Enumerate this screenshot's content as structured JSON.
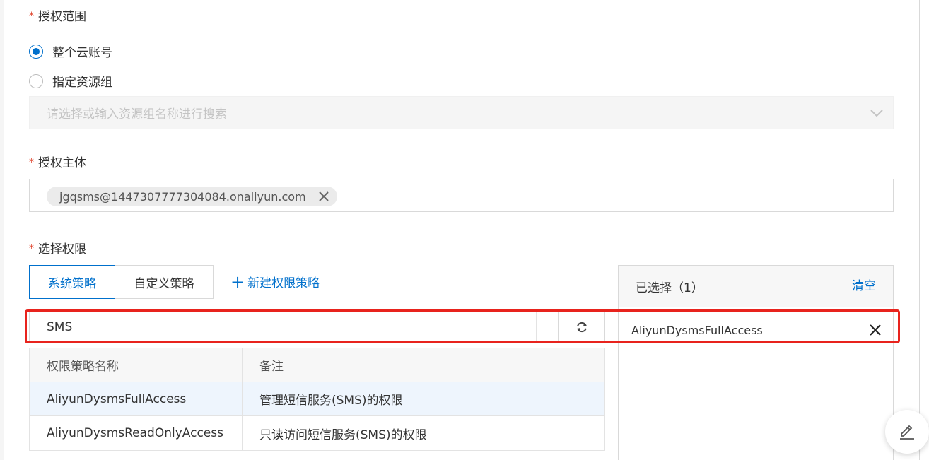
{
  "scope": {
    "label": "授权范围",
    "options": [
      {
        "label": "整个云账号",
        "checked": true
      },
      {
        "label": "指定资源组",
        "checked": false
      }
    ],
    "resource_group_placeholder": "请选择或输入资源组名称进行搜索"
  },
  "principal": {
    "label": "授权主体",
    "tag": "jgqsms@1447307777304084.onaliyun.com"
  },
  "permissions": {
    "label": "选择权限",
    "tabs": [
      {
        "label": "系统策略",
        "active": true
      },
      {
        "label": "自定义策略",
        "active": false
      }
    ],
    "new_policy_label": "新建权限策略",
    "search_value": "SMS",
    "table": {
      "headers": [
        "权限策略名称",
        "备注"
      ],
      "rows": [
        {
          "name": "AliyunDysmsFullAccess",
          "note": "管理短信服务(SMS)的权限",
          "selected": true
        },
        {
          "name": "AliyunDysmsReadOnlyAccess",
          "note": "只读访问短信服务(SMS)的权限",
          "selected": false
        }
      ]
    },
    "selected_panel": {
      "title": "已选择（1）",
      "clear_label": "清空",
      "items": [
        "AliyunDysmsFullAccess"
      ]
    }
  },
  "colors": {
    "accent": "#0070cc",
    "required": "#e0462f",
    "highlight": "#e8231d"
  },
  "icons": [
    "close-icon",
    "chevron-down-icon",
    "refresh-icon",
    "plus-icon",
    "edit-icon"
  ]
}
